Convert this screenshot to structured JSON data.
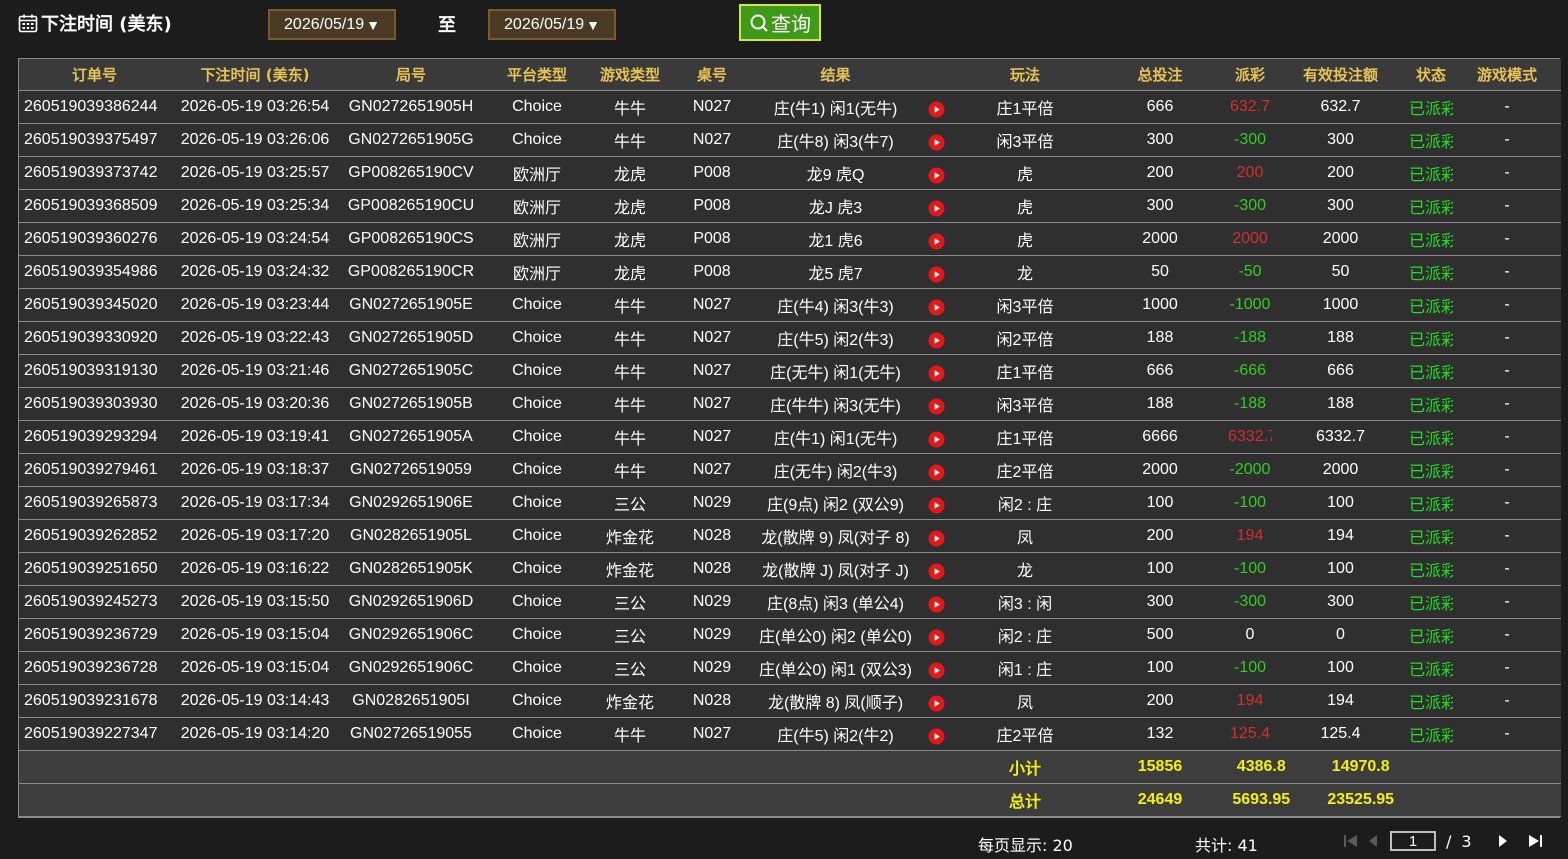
{
  "header": {
    "title": "下注时间 (美东)",
    "start_date": "2026/05/19",
    "to_label": "至",
    "end_date": "2026/05/19",
    "query_label": "查询"
  },
  "columns": [
    "订单号",
    "下注时间 (美东)",
    "局号",
    "平台类型",
    "游戏类型",
    "桌号",
    "结果",
    "",
    "玩法",
    "总投注",
    "派彩",
    "有效投注额",
    "状态",
    "游戏模式"
  ],
  "rows": [
    {
      "order": "260519039386244",
      "time": "2026-05-19 03:26:54",
      "round": "GN0272651905H",
      "platform": "Choice",
      "game": "牛牛",
      "table": "N027",
      "result": "庄(牛1) 闲1(无牛)",
      "play": "庄1平倍",
      "bet": "666",
      "payout": "632.7",
      "payout_type": "win",
      "valid": "632.7",
      "status": "已派彩",
      "mode": "-"
    },
    {
      "order": "260519039375497",
      "time": "2026-05-19 03:26:06",
      "round": "GN0272651905G",
      "platform": "Choice",
      "game": "牛牛",
      "table": "N027",
      "result": "庄(牛8) 闲3(牛7)",
      "play": "闲3平倍",
      "bet": "300",
      "payout": "-300",
      "payout_type": "loss",
      "valid": "300",
      "status": "已派彩",
      "mode": "-"
    },
    {
      "order": "260519039373742",
      "time": "2026-05-19 03:25:57",
      "round": "GP008265190CV",
      "platform": "欧洲厅",
      "game": "龙虎",
      "table": "P008",
      "result": "龙9 虎Q",
      "play": "虎",
      "bet": "200",
      "payout": "200",
      "payout_type": "win",
      "valid": "200",
      "status": "已派彩",
      "mode": "-"
    },
    {
      "order": "260519039368509",
      "time": "2026-05-19 03:25:34",
      "round": "GP008265190CU",
      "platform": "欧洲厅",
      "game": "龙虎",
      "table": "P008",
      "result": "龙J 虎3",
      "play": "虎",
      "bet": "300",
      "payout": "-300",
      "payout_type": "loss",
      "valid": "300",
      "status": "已派彩",
      "mode": "-"
    },
    {
      "order": "260519039360276",
      "time": "2026-05-19 03:24:54",
      "round": "GP008265190CS",
      "platform": "欧洲厅",
      "game": "龙虎",
      "table": "P008",
      "result": "龙1 虎6",
      "play": "虎",
      "bet": "2000",
      "payout": "2000",
      "payout_type": "win",
      "valid": "2000",
      "status": "已派彩",
      "mode": "-"
    },
    {
      "order": "260519039354986",
      "time": "2026-05-19 03:24:32",
      "round": "GP008265190CR",
      "platform": "欧洲厅",
      "game": "龙虎",
      "table": "P008",
      "result": "龙5 虎7",
      "play": "龙",
      "bet": "50",
      "payout": "-50",
      "payout_type": "loss",
      "valid": "50",
      "status": "已派彩",
      "mode": "-"
    },
    {
      "order": "260519039345020",
      "time": "2026-05-19 03:23:44",
      "round": "GN0272651905E",
      "platform": "Choice",
      "game": "牛牛",
      "table": "N027",
      "result": "庄(牛4) 闲3(牛3)",
      "play": "闲3平倍",
      "bet": "1000",
      "payout": "-1000",
      "payout_type": "loss",
      "valid": "1000",
      "status": "已派彩",
      "mode": "-"
    },
    {
      "order": "260519039330920",
      "time": "2026-05-19 03:22:43",
      "round": "GN0272651905D",
      "platform": "Choice",
      "game": "牛牛",
      "table": "N027",
      "result": "庄(牛5) 闲2(牛3)",
      "play": "闲2平倍",
      "bet": "188",
      "payout": "-188",
      "payout_type": "loss",
      "valid": "188",
      "status": "已派彩",
      "mode": "-"
    },
    {
      "order": "260519039319130",
      "time": "2026-05-19 03:21:46",
      "round": "GN0272651905C",
      "platform": "Choice",
      "game": "牛牛",
      "table": "N027",
      "result": "庄(无牛) 闲1(无牛)",
      "play": "庄1平倍",
      "bet": "666",
      "payout": "-666",
      "payout_type": "loss",
      "valid": "666",
      "status": "已派彩",
      "mode": "-"
    },
    {
      "order": "260519039303930",
      "time": "2026-05-19 03:20:36",
      "round": "GN0272651905B",
      "platform": "Choice",
      "game": "牛牛",
      "table": "N027",
      "result": "庄(牛牛) 闲3(无牛)",
      "play": "闲3平倍",
      "bet": "188",
      "payout": "-188",
      "payout_type": "loss",
      "valid": "188",
      "status": "已派彩",
      "mode": "-"
    },
    {
      "order": "260519039293294",
      "time": "2026-05-19 03:19:41",
      "round": "GN0272651905A",
      "platform": "Choice",
      "game": "牛牛",
      "table": "N027",
      "result": "庄(牛1) 闲1(无牛)",
      "play": "庄1平倍",
      "bet": "6666",
      "payout": "6332.7",
      "payout_type": "win",
      "valid": "6332.7",
      "status": "已派彩",
      "mode": "-"
    },
    {
      "order": "260519039279461",
      "time": "2026-05-19 03:18:37",
      "round": "GN02726519059",
      "platform": "Choice",
      "game": "牛牛",
      "table": "N027",
      "result": "庄(无牛) 闲2(牛3)",
      "play": "庄2平倍",
      "bet": "2000",
      "payout": "-2000",
      "payout_type": "loss",
      "valid": "2000",
      "status": "已派彩",
      "mode": "-"
    },
    {
      "order": "260519039265873",
      "time": "2026-05-19 03:17:34",
      "round": "GN0292651906E",
      "platform": "Choice",
      "game": "三公",
      "table": "N029",
      "result": "庄(9点) 闲2 (双公9)",
      "play": "闲2 : 庄",
      "bet": "100",
      "payout": "-100",
      "payout_type": "loss",
      "valid": "100",
      "status": "已派彩",
      "mode": "-"
    },
    {
      "order": "260519039262852",
      "time": "2026-05-19 03:17:20",
      "round": "GN0282651905L",
      "platform": "Choice",
      "game": "炸金花",
      "table": "N028",
      "result": "龙(散牌 9) 凤(对子 8)",
      "play": "凤",
      "bet": "200",
      "payout": "194",
      "payout_type": "win",
      "valid": "194",
      "status": "已派彩",
      "mode": "-"
    },
    {
      "order": "260519039251650",
      "time": "2026-05-19 03:16:22",
      "round": "GN0282651905K",
      "platform": "Choice",
      "game": "炸金花",
      "table": "N028",
      "result": "龙(散牌 J) 凤(对子 J)",
      "play": "龙",
      "bet": "100",
      "payout": "-100",
      "payout_type": "loss",
      "valid": "100",
      "status": "已派彩",
      "mode": "-"
    },
    {
      "order": "260519039245273",
      "time": "2026-05-19 03:15:50",
      "round": "GN0292651906D",
      "platform": "Choice",
      "game": "三公",
      "table": "N029",
      "result": "庄(8点) 闲3 (单公4)",
      "play": "闲3 : 闲",
      "bet": "300",
      "payout": "-300",
      "payout_type": "loss",
      "valid": "300",
      "status": "已派彩",
      "mode": "-"
    },
    {
      "order": "260519039236729",
      "time": "2026-05-19 03:15:04",
      "round": "GN0292651906C",
      "platform": "Choice",
      "game": "三公",
      "table": "N029",
      "result": "庄(单公0) 闲2 (单公0)",
      "play": "闲2 : 庄",
      "bet": "500",
      "payout": "0",
      "payout_type": "zero",
      "valid": "0",
      "status": "已派彩",
      "mode": "-"
    },
    {
      "order": "260519039236728",
      "time": "2026-05-19 03:15:04",
      "round": "GN0292651906C",
      "platform": "Choice",
      "game": "三公",
      "table": "N029",
      "result": "庄(单公0) 闲1 (双公3)",
      "play": "闲1 : 庄",
      "bet": "100",
      "payout": "-100",
      "payout_type": "loss",
      "valid": "100",
      "status": "已派彩",
      "mode": "-"
    },
    {
      "order": "260519039231678",
      "time": "2026-05-19 03:14:43",
      "round": "GN0282651905I",
      "platform": "Choice",
      "game": "炸金花",
      "table": "N028",
      "result": "龙(散牌 8) 凤(顺子)",
      "play": "凤",
      "bet": "200",
      "payout": "194",
      "payout_type": "win",
      "valid": "194",
      "status": "已派彩",
      "mode": "-"
    },
    {
      "order": "260519039227347",
      "time": "2026-05-19 03:14:20",
      "round": "GN02726519055",
      "platform": "Choice",
      "game": "牛牛",
      "table": "N027",
      "result": "庄(牛5) 闲2(牛2)",
      "play": "庄2平倍",
      "bet": "132",
      "payout": "125.4",
      "payout_type": "win",
      "valid": "125.4",
      "status": "已派彩",
      "mode": "-"
    }
  ],
  "subtotal": {
    "label": "小计",
    "bet": "15856",
    "payout": "4386.8",
    "valid": "14970.8"
  },
  "grand_total": {
    "label": "总计",
    "bet": "24649",
    "payout": "5693.95",
    "valid": "23525.95"
  },
  "footer": {
    "per_page": "每页显示: 20",
    "total": "共计: 41",
    "current_page": "1",
    "slash": "/",
    "total_pages": "3"
  },
  "colors": {
    "header_text": "#e7c256",
    "win": "#d32f2f",
    "loss": "#33cc22",
    "status": "#22dd22",
    "sum_text": "#f4f20a",
    "button": "#3f9a1a"
  }
}
